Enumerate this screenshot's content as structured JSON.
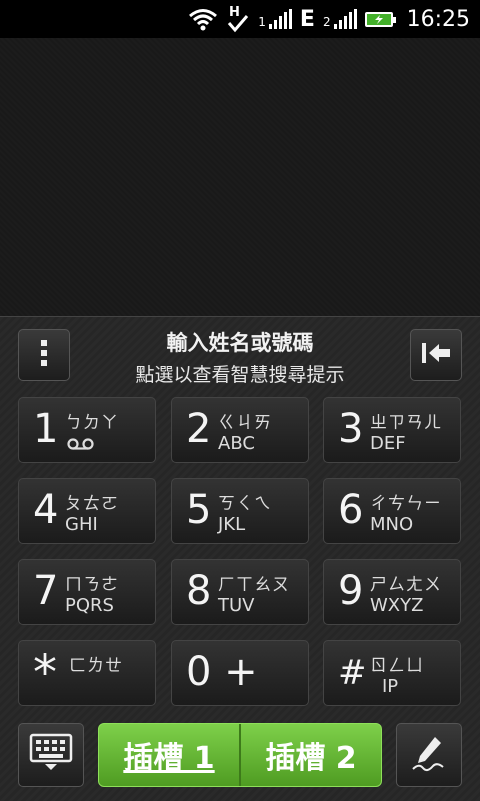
{
  "status": {
    "network_type": "E",
    "sim1_label": "1",
    "sim2_label": "2",
    "time": "16:25"
  },
  "hint": {
    "line1": "輸入姓名或號碼",
    "line2": "點選以查看智慧搜尋提示"
  },
  "keys": [
    {
      "digit": "1",
      "bopo": "ㄅㄉㄚ",
      "letters": ""
    },
    {
      "digit": "2",
      "bopo": "ㄍㄐㄞ",
      "letters": "ABC"
    },
    {
      "digit": "3",
      "bopo": "ㄓㄗㄢㄦ",
      "letters": "DEF"
    },
    {
      "digit": "4",
      "bopo": "ㄆㄊㄛ",
      "letters": "GHI"
    },
    {
      "digit": "5",
      "bopo": "ㄎㄑㄟ",
      "letters": "JKL"
    },
    {
      "digit": "6",
      "bopo": "ㄔㄘㄣㄧ",
      "letters": "MNO"
    },
    {
      "digit": "7",
      "bopo": "ㄇㄋㄜ",
      "letters": "PQRS"
    },
    {
      "digit": "8",
      "bopo": "ㄏㄒㄠㄡ",
      "letters": "TUV"
    },
    {
      "digit": "9",
      "bopo": "ㄕㄙㄤㄨ",
      "letters": "WXYZ"
    },
    {
      "digit": "*",
      "bopo": "ㄈㄌㄝ",
      "letters": ""
    },
    {
      "digit": "0 +",
      "bopo": "",
      "letters": ""
    },
    {
      "digit": "#",
      "bopo": "ㄖㄥㄩ",
      "letters": "IP"
    }
  ],
  "slots": {
    "slot1": "插槽 1",
    "slot2": "插槽 2"
  },
  "icons": {
    "menu": "menu-dots-icon",
    "backspace": "backspace-icon",
    "keyboard": "keyboard-icon",
    "handwriting": "pen-icon"
  },
  "colors": {
    "accent_green": "#5fae2f",
    "battery_green": "#43b02a"
  }
}
